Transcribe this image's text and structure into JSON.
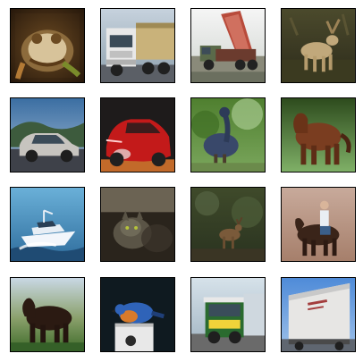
{
  "figure": {
    "rows": 4,
    "cols": 4,
    "thumbnails": [
      {
        "subject": "frog-icon"
      },
      {
        "subject": "truck-icon"
      },
      {
        "subject": "truck-icon"
      },
      {
        "subject": "deer-icon"
      },
      {
        "subject": "automobile-icon"
      },
      {
        "subject": "automobile-icon"
      },
      {
        "subject": "bird-icon"
      },
      {
        "subject": "horse-icon"
      },
      {
        "subject": "ship-icon"
      },
      {
        "subject": "cat-icon"
      },
      {
        "subject": "deer-icon"
      },
      {
        "subject": "horse-icon"
      },
      {
        "subject": "horse-icon"
      },
      {
        "subject": "bird-icon"
      },
      {
        "subject": "truck-icon"
      },
      {
        "subject": "truck-icon"
      }
    ]
  }
}
